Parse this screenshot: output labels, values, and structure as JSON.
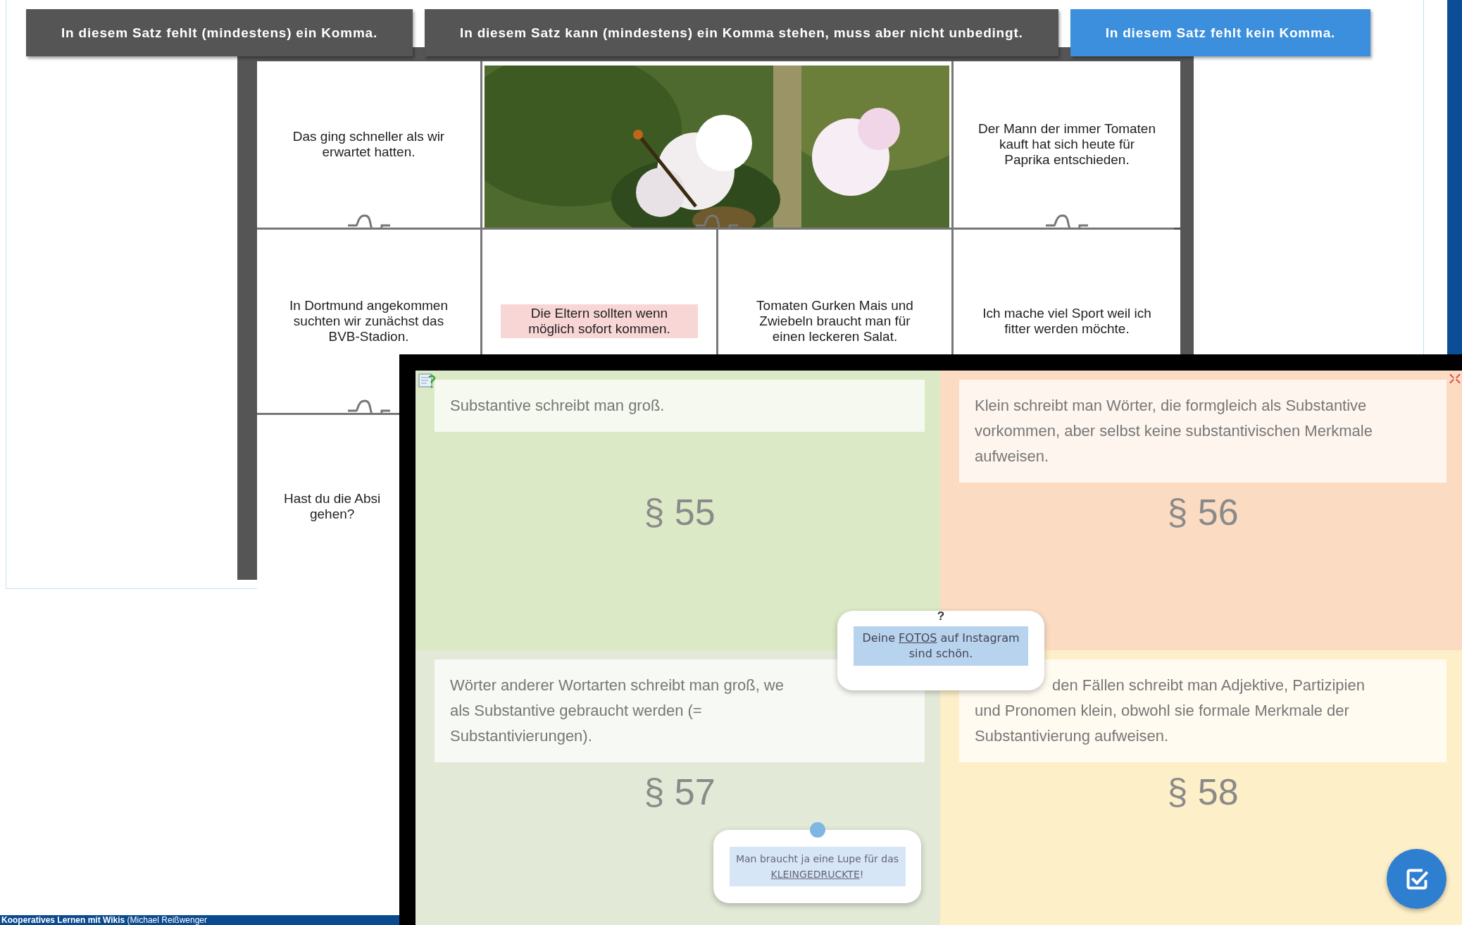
{
  "answer_buttons": [
    {
      "label": "In diesem Satz fehlt (mindestens) ein Komma.",
      "selected": false
    },
    {
      "label": "In diesem Satz kann (mindestens) ein Komma stehen, muss aber nicht unbedingt.",
      "selected": false
    },
    {
      "label": "In diesem Satz fehlt kein Komma.",
      "selected": true
    }
  ],
  "puzzle": {
    "pieces": [
      {
        "kind": "text",
        "text": "Das ging schneller als wir erwartet hatten.",
        "highlighted": false
      },
      {
        "kind": "picture"
      },
      {
        "kind": "text",
        "text": "Der Mann der immer Tomaten kauft hat sich heute für Paprika entschieden.",
        "highlighted": false
      },
      {
        "kind": "text",
        "text": "In Dortmund angekommen suchten wir zunächst das BVB-Stadion.",
        "highlighted": false
      },
      {
        "kind": "text",
        "text": "Die Eltern sollten wenn möglich sofort kommen.",
        "highlighted": true
      },
      {
        "kind": "text",
        "text": "Tomaten Gurken Mais und Zwiebeln braucht man für einen leckeren Salat.",
        "highlighted": false
      },
      {
        "kind": "text",
        "text": "Ich mache viel Sport weil ich fitter werden möchte.",
        "highlighted": false
      },
      {
        "kind": "cut",
        "lines": [
          "Hast du die Absi",
          "gehen?"
        ],
        "highlighted": false
      }
    ]
  },
  "overlay": {
    "quadrants": [
      {
        "color": "#dce9c6",
        "kind": "plain",
        "rule": "Substantive schreibt man groß.",
        "paragraph": "§ 55"
      },
      {
        "color": "#fbdcc2",
        "kind": "plain",
        "rule": "Klein schreibt man Wörter, die formgleich als Substantive vorkommen, aber selbst keine substantivischen Merkmale aufweisen.",
        "paragraph": "§ 56"
      },
      {
        "color": "#e2e9d6",
        "kind": "cut-end",
        "lines": [
          "Wörter anderer Wortarten schreibt man groß, we",
          "als Substantive gebraucht werden (=",
          "Substantivierungen)."
        ],
        "paragraph": "§ 57"
      },
      {
        "color": "#fdefc8",
        "kind": "cut-start",
        "lines": [
          "den Fällen schreibt man Adjektive, Partizipien",
          "und Pronomen klein, obwohl sie formale Merkmale der",
          "Substantivierung aufweisen."
        ],
        "paragraph": "§ 58"
      }
    ],
    "popups": [
      {
        "kind": "question",
        "mark": "?",
        "text": "Deine **FOTOS** auf Instagram sind schön."
      },
      {
        "kind": "pin",
        "text": "Man braucht ja eine Lupe für das **KLEINGEDRUCKTE**!"
      }
    ]
  },
  "caption": "**Kooperatives Lernen mit Wikis** (Michael Reißwenger"
}
